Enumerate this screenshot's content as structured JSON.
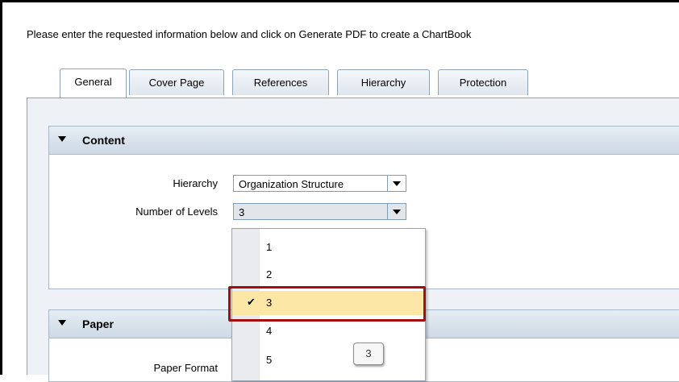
{
  "intro_text": "Please enter the requested information below and click on Generate PDF to create a ChartBook",
  "tabs": [
    {
      "label": "General",
      "active": true
    },
    {
      "label": "Cover Page",
      "active": false
    },
    {
      "label": "References",
      "active": false
    },
    {
      "label": "Hierarchy",
      "active": false
    },
    {
      "label": "Protection",
      "active": false
    }
  ],
  "content_panel": {
    "title": "Content",
    "hierarchy": {
      "label": "Hierarchy",
      "value": "Organization Structure"
    },
    "levels": {
      "label": "Number of Levels",
      "value": "3"
    }
  },
  "paper_panel": {
    "title": "Paper",
    "paper_format_label": "Paper Format"
  },
  "dropdown": {
    "options": [
      "1",
      "2",
      "3",
      "4",
      "5"
    ],
    "selected": "3",
    "check_glyph": "✔"
  },
  "tooltip": "3",
  "colors": {
    "selection_highlight": "#fde7a7",
    "annotation_outline": "#a50e0e",
    "panel_header": "#cdd9e5"
  }
}
